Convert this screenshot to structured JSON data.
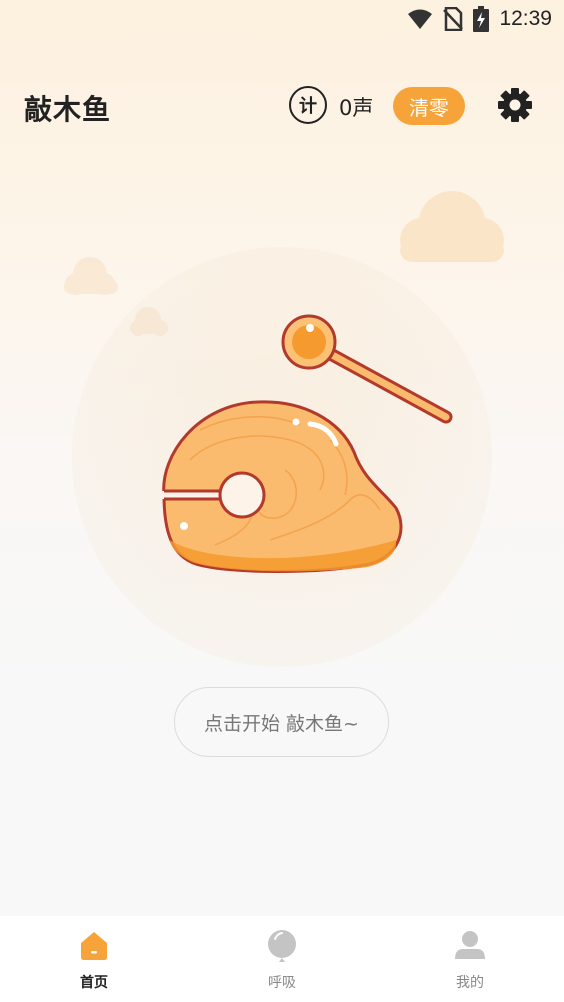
{
  "status_bar": {
    "time": "12:39",
    "icons": [
      "wifi-icon",
      "no-sim-icon",
      "battery-charging-icon"
    ]
  },
  "header": {
    "title": "敲木鱼",
    "counter_icon_label": "计",
    "count_text": "0声",
    "reset_label": "清零",
    "settings_icon": "gear-icon"
  },
  "main": {
    "hint": "点击开始 敲木鱼~"
  },
  "tabbar": {
    "tabs": [
      {
        "label": "首页",
        "icon": "home-icon",
        "active": true
      },
      {
        "label": "呼吸",
        "icon": "balloon-icon",
        "active": false
      },
      {
        "label": "我的",
        "icon": "person-icon",
        "active": false
      }
    ]
  },
  "colors": {
    "accent": "#f6a33a",
    "fish_fill": "#fbbb6e",
    "fish_outline": "#b3392c",
    "text_dark": "#222222",
    "text_muted": "#888888"
  }
}
